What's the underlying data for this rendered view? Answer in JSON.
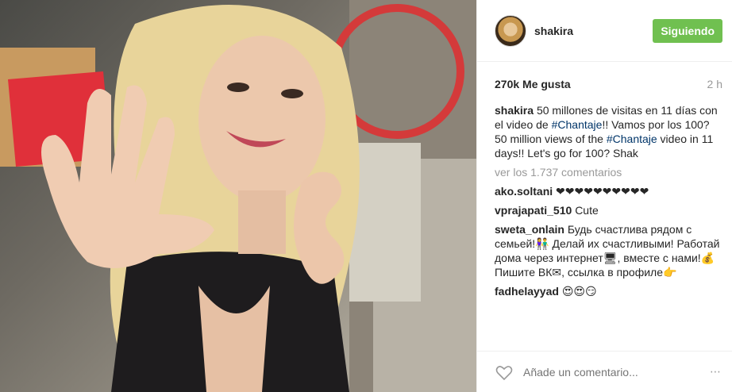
{
  "header": {
    "username": "shakira",
    "follow_label": "Siguiendo"
  },
  "stats": {
    "likes": "270k Me gusta",
    "time": "2 h"
  },
  "caption": {
    "user": "shakira",
    "text_1": "50 millones de visitas en 11 días con el video de ",
    "tag_1": "#Chantaje",
    "text_2": "!! Vamos por los 100?",
    "text_3": "50 million views of the ",
    "tag_2": "#Chantaje",
    "text_4": " video in 11 days!! Let's go for 100? Shak"
  },
  "view_more": "ver los 1.737 comentarios",
  "comments": [
    {
      "user": "ako.soltani",
      "text": "❤❤❤❤❤❤❤❤❤❤"
    },
    {
      "user": "vprajapati_510",
      "text": "Cute"
    },
    {
      "user": "sweta_onlain",
      "text": "Будь счастлива рядом с семьей!👫 Делай их счастливыми! Работай дома через интернет🖥, вместе с нами!💰 Пишите ВК✉, ссылка в профиле👉"
    },
    {
      "user": "fadhelayyad",
      "text": "😍😍😏"
    }
  ],
  "footer": {
    "add_comment_placeholder": "Añade un comentario...",
    "more_icon": "⋯"
  },
  "colors": {
    "follow_button": "#70c050",
    "hashtag": "#003569",
    "muted": "#999999"
  }
}
